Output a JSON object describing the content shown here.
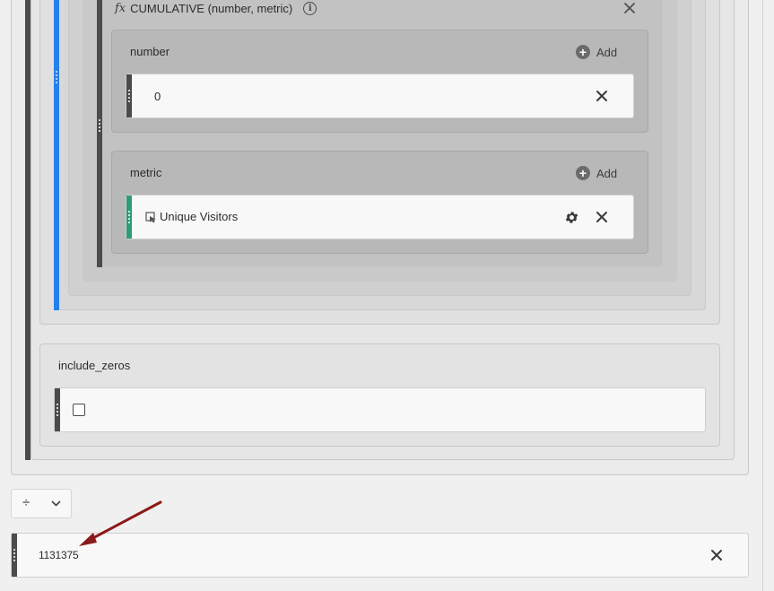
{
  "function": {
    "icon": "fx-icon",
    "title": "CUMULATIVE (number, metric)"
  },
  "param_number": {
    "label": "number",
    "add_label": "Add",
    "value": "0"
  },
  "param_metric": {
    "label": "metric",
    "add_label": "Add",
    "value": "Unique Visitors",
    "value_icon": "segment-metric-icon"
  },
  "param_include_zeros": {
    "label": "include_zeros",
    "checked": false
  },
  "operator": {
    "symbol": "÷"
  },
  "static_number": {
    "value": "1131375"
  },
  "colors": {
    "blue_bar": "#2680eb",
    "green_bar": "#2d9d78",
    "arrow": "#8b1a1a",
    "dark_bar": "#4b4b4b"
  }
}
